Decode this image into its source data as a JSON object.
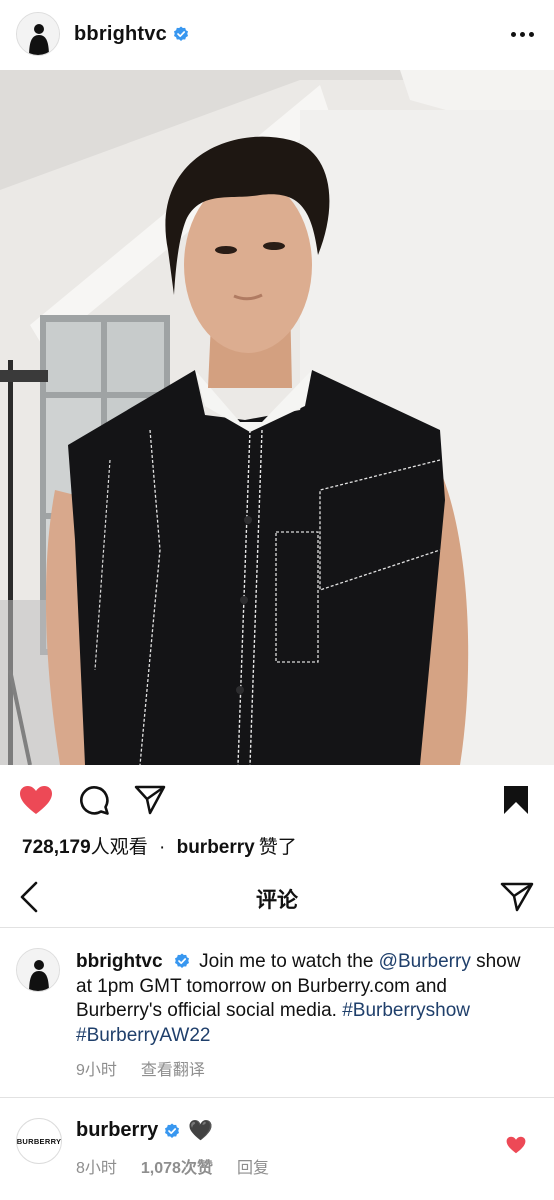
{
  "post": {
    "username": "bbrightvc",
    "more_icon": "more-horizontal-icon",
    "verified_icon": "verified-badge-icon"
  },
  "media": {
    "type": "video",
    "description_icon": "person-icon",
    "sound_icon": "speaker-icon"
  },
  "actions": {
    "like_icon": "heart-filled-icon",
    "like_color": "#ed4956",
    "comment_icon": "comment-icon",
    "share_icon": "send-icon",
    "save_icon": "bookmark-filled-icon"
  },
  "stats": {
    "view_count": "728,179",
    "view_suffix": "人观看",
    "separator": "·",
    "liked_by": "burberry",
    "liked_suffix": "赞了"
  },
  "comments_bar": {
    "title": "评论",
    "back_icon": "chevron-left-icon",
    "share_icon": "send-icon"
  },
  "caption": {
    "username": "bbrightvc",
    "text_before_mention": "Join me to watch the",
    "mention": "@Burberry",
    "text_after_mention": "show at 1pm GMT tomorrow on Burberry.com and Burberry's official social media.",
    "hashtag_1": "#Burberryshow",
    "hashtag_2": "#BurberryAW22",
    "time": "9小时",
    "translate": "查看翻译",
    "link_color": "#1f3f6b"
  },
  "comment": {
    "avatar_text": "BURBERRY",
    "username": "burberry",
    "text": "🖤",
    "time": "8小时",
    "likes": "1,078次赞",
    "reply": "回复",
    "like_icon": "heart-filled-icon"
  }
}
